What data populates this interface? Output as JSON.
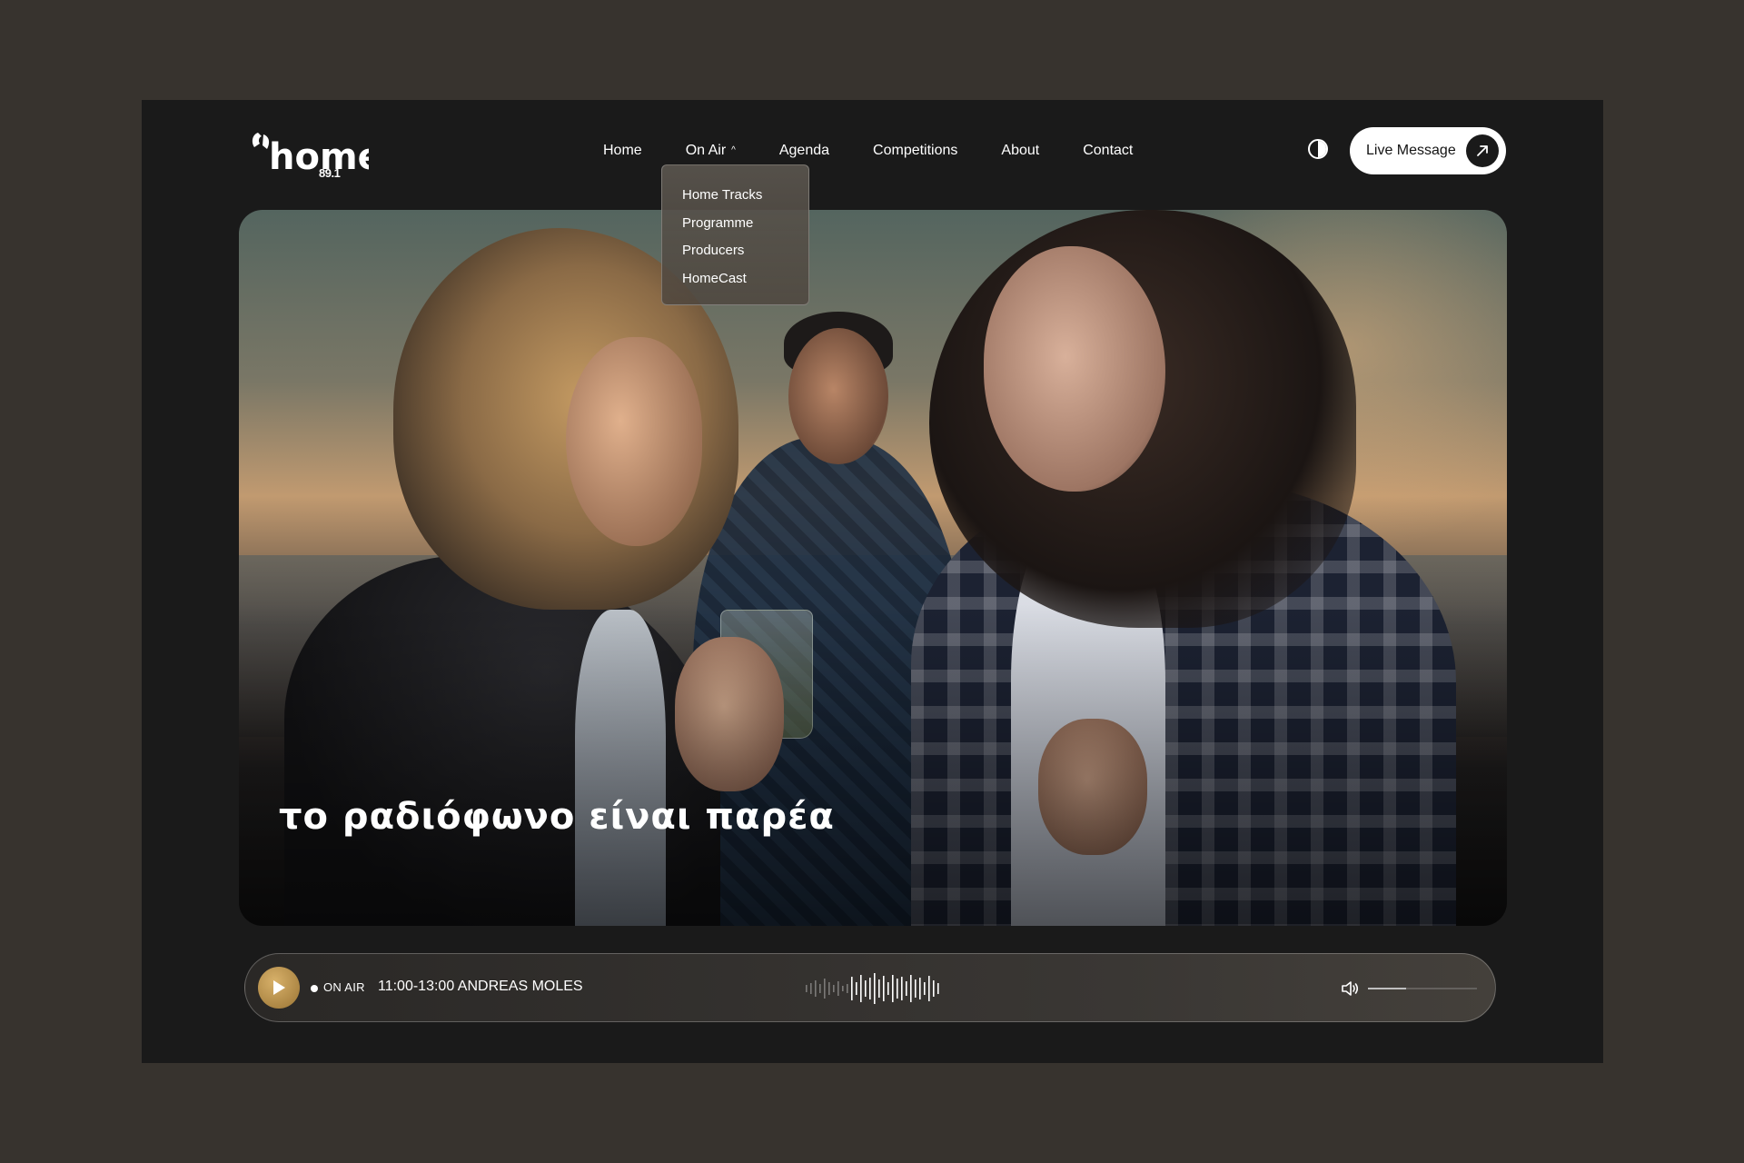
{
  "header": {
    "logo_word": "home",
    "logo_frequency": "89.1",
    "nav": [
      {
        "label": "Home"
      },
      {
        "label": "On Air",
        "expanded": true
      },
      {
        "label": "Agenda"
      },
      {
        "label": "Competitions"
      },
      {
        "label": "About"
      },
      {
        "label": "Contact"
      }
    ],
    "live_button_label": "Live Message"
  },
  "dropdown": {
    "items": [
      "Home Tracks",
      "Programme",
      "Producers",
      "HomeCast"
    ]
  },
  "hero": {
    "tagline": "το ραδιόφωνο είναι παρέα"
  },
  "player": {
    "status_label": "ON AIR",
    "show": "11:00-13:00 ANDREAS MOLES",
    "volume_fraction": 0.35
  },
  "colors": {
    "page_bg": "#37332e",
    "frame_bg": "#1a1a1a",
    "accent_gold": "#c8a25a",
    "text": "#ffffff"
  }
}
